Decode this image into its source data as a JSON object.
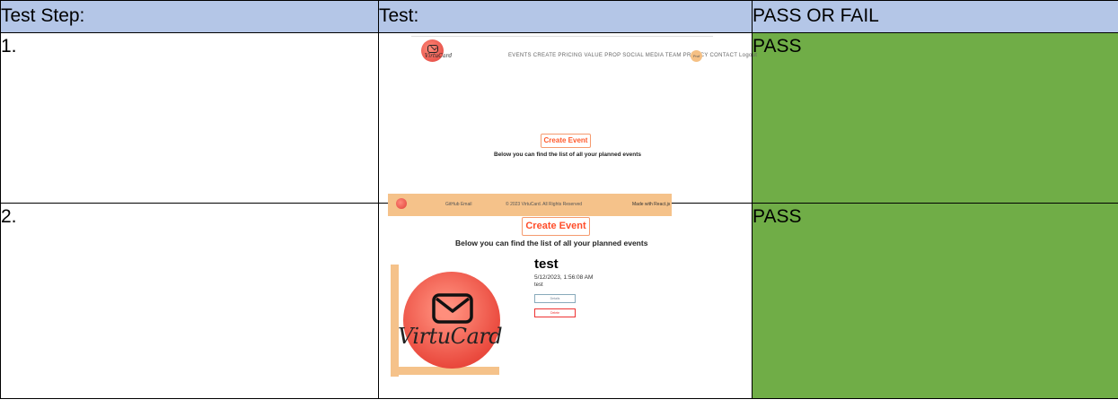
{
  "table": {
    "headers": [
      "Test Step:",
      "Test:",
      "PASS OR FAIL"
    ],
    "rows": [
      {
        "step": "1.",
        "result": "PASS"
      },
      {
        "step": "2.",
        "result": "PASS"
      }
    ]
  },
  "shot1": {
    "logo_text": "VirtuCard",
    "nav_text": "EVENTS   CREATE   PRICING   VALUE PROP   SOCIAL MEDIA   TEAM   PRIVACY   CONTACT   Logout",
    "nav_badge": "Prof",
    "create_event_label": "Create Event",
    "subtitle": "Below you can find the list of all your planned events",
    "footer_links": "GitHub   Email",
    "footer_copyright": "© 2023 VirtuCard. All Rights Reserved",
    "footer_credit": "Made with React.js"
  },
  "shot2": {
    "create_event_label": "Create Event",
    "subtitle": "Below you can find the list of all your planned events",
    "logo_text": "VirtuCard",
    "event_title": "test",
    "event_date": "5/12/2023, 1:56:08 AM",
    "event_description": "test",
    "details_label": "Details",
    "delete_label": "Delete"
  },
  "colors": {
    "header_bg": "#b4c6e7",
    "pass_bg": "#70ad47",
    "accent": "#ff4d2a",
    "footer_bg": "#f5c28a"
  }
}
